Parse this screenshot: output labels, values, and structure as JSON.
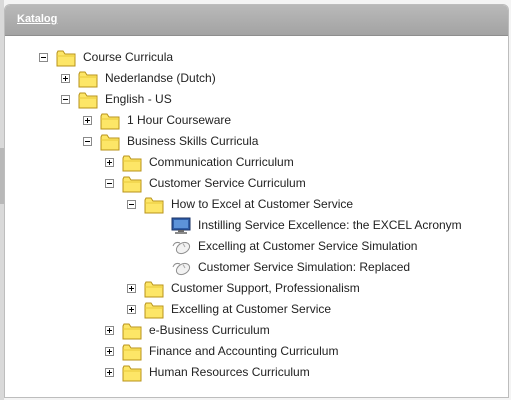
{
  "panel": {
    "title": "Katalog"
  },
  "tree": [
    {
      "label": "Course Curricula",
      "toggle": "minus",
      "icon": "folder"
    },
    {
      "label": "Nederlandse (Dutch)",
      "toggle": "plus",
      "icon": "folder"
    },
    {
      "label": "English - US",
      "toggle": "minus",
      "icon": "folder"
    },
    {
      "label": "1 Hour Courseware",
      "toggle": "plus",
      "icon": "folder"
    },
    {
      "label": "Business Skills Curricula",
      "toggle": "minus",
      "icon": "folder"
    },
    {
      "label": "Communication Curriculum",
      "toggle": "plus",
      "icon": "folder"
    },
    {
      "label": "Customer Service Curriculum",
      "toggle": "minus",
      "icon": "folder"
    },
    {
      "label": "How to Excel at Customer Service",
      "toggle": "minus",
      "icon": "folder"
    },
    {
      "label": "Instilling Service Excellence: the EXCEL Acronym",
      "toggle": "none",
      "icon": "monitor"
    },
    {
      "label": "Excelling at Customer Service Simulation",
      "toggle": "none",
      "icon": "mouse"
    },
    {
      "label": "Customer Service Simulation: Replaced",
      "toggle": "none",
      "icon": "mouse"
    },
    {
      "label": "Customer Support, Professionalism",
      "toggle": "plus",
      "icon": "folder"
    },
    {
      "label": "Excelling at Customer Service",
      "toggle": "plus",
      "icon": "folder"
    },
    {
      "label": "e-Business Curriculum",
      "toggle": "plus",
      "icon": "folder"
    },
    {
      "label": "Finance and Accounting Curriculum",
      "toggle": "plus",
      "icon": "folder"
    },
    {
      "label": "Human Resources Curriculum",
      "toggle": "plus",
      "icon": "folder"
    }
  ]
}
